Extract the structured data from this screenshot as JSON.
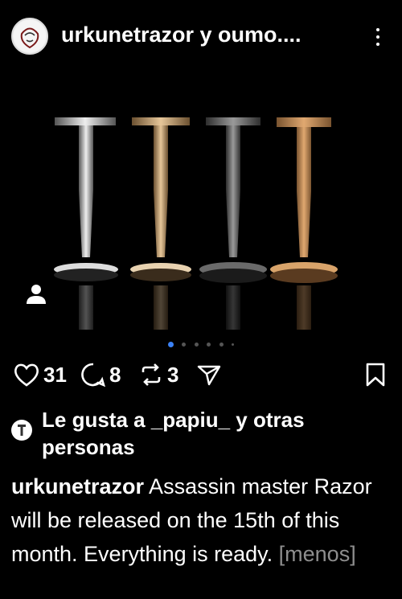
{
  "post": {
    "header_username": "urkunetrazor y oumo....",
    "likes_text": "Le gusta a _papiu_ y otras personas",
    "caption_username": "urkunetrazor",
    "caption_text": " Assassin master Razor will be released on the 15th of this month. Everything is ready. ",
    "caption_more": "[menos]"
  },
  "actions": {
    "likes": "31",
    "comments": "8",
    "reposts": "3"
  },
  "carousel": {
    "count": 6,
    "active_index": 0
  },
  "colors": {
    "background": "#000000",
    "text": "#ffffff",
    "muted": "#8e8e8e",
    "accent": "#3b82f6"
  }
}
